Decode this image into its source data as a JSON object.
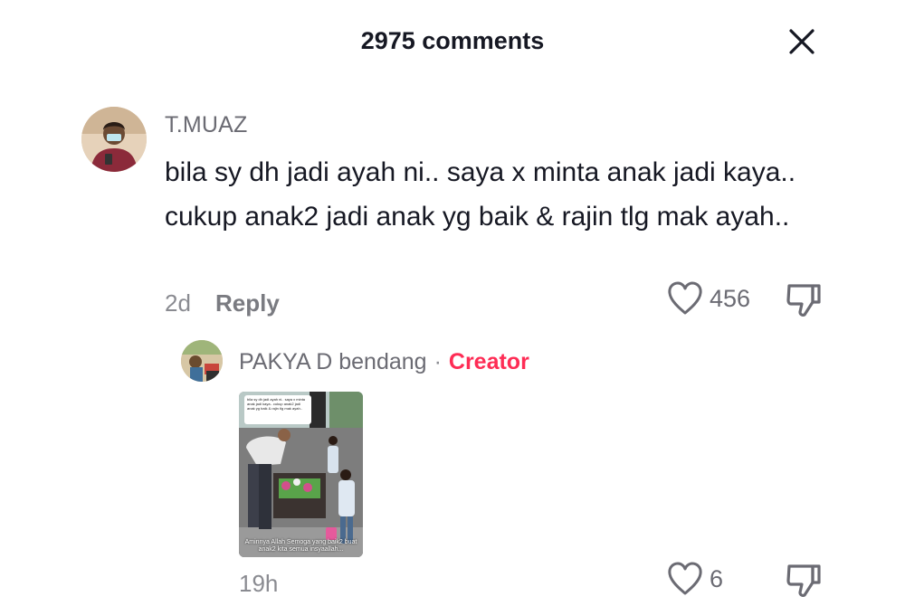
{
  "header": {
    "title": "2975 comments",
    "close_icon": "close-icon"
  },
  "comment": {
    "username": "T.MUAZ",
    "text": "bila sy dh jadi ayah ni.. saya x minta anak jadi kaya.. cukup anak2 jadi anak yg baik & rajin tlg mak ayah..",
    "time": "2d",
    "reply_label": "Reply",
    "likes": "456"
  },
  "reply": {
    "username": "PAKYA D bendang",
    "separator": "·",
    "badge": "Creator",
    "badge_color": "#fe2c55",
    "video_quote": "bila sy dh jadi ayah ni.. saya x minta anak jadi kaya.. cukup anak2 jadi anak yg baik & rajin tlg mak ayah..",
    "video_caption": "Aminnya Allah Semoga yang baik2 buat anak2 kita semua insyaallah...",
    "time": "19h",
    "likes": "6"
  }
}
